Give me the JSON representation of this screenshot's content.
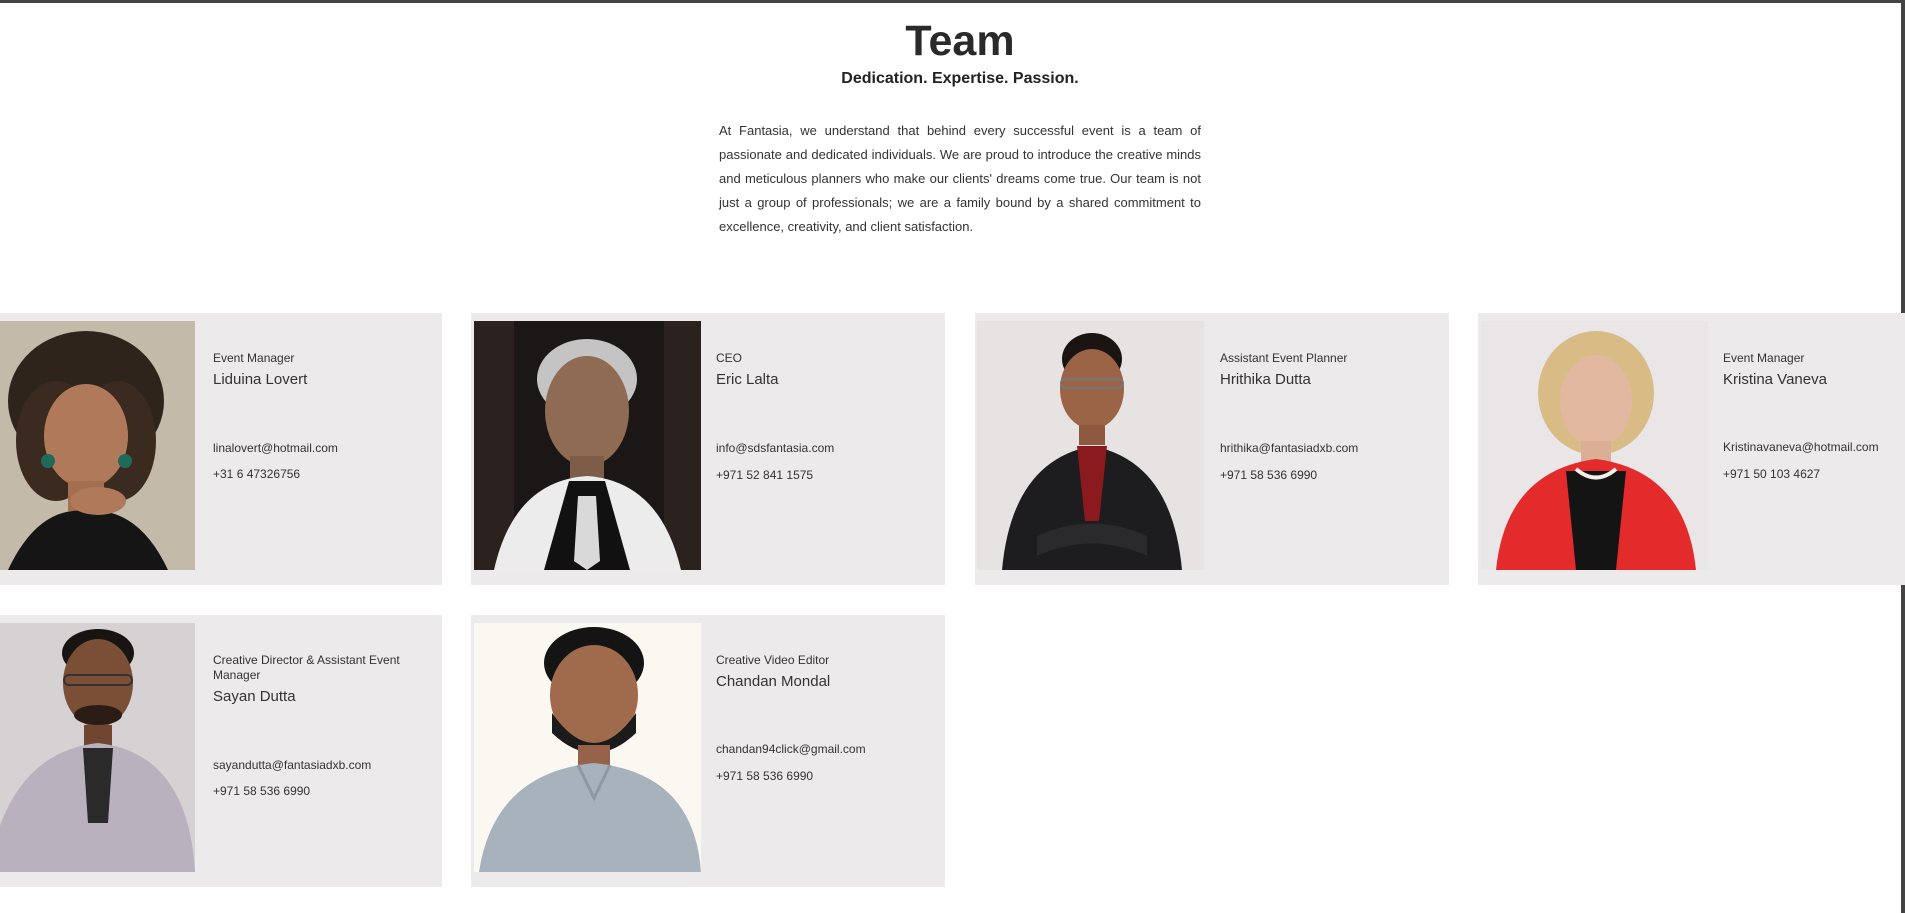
{
  "section": {
    "title": "Team",
    "subtitle": "Dedication. Expertise. Passion.",
    "intro": "At Fantasia, we understand that behind every successful event is a team of passionate and dedicated individuals. We are proud to introduce the creative minds and meticulous planners who make our clients' dreams come true. Our team is not just a group of professionals; we are a family bound by a shared commitment to excellence, creativity, and client satisfaction."
  },
  "members": [
    {
      "role": "Event Manager",
      "name": "Liduina Lovert",
      "email": "linalovert@hotmail.com",
      "phone": "+31 6 47326756"
    },
    {
      "role": "CEO",
      "name": "Eric Lalta",
      "email": "info@sdsfantasia.com",
      "phone": "+971 52 841 1575"
    },
    {
      "role": "Assistant Event Planner",
      "name": "Hrithika Dutta",
      "email": "hrithika@fantasiadxb.com",
      "phone": "+971 58 536 6990"
    },
    {
      "role": "Event Manager",
      "name": "Kristina Vaneva",
      "email": "Kristinavaneva@hotmail.com",
      "phone": "+971 50 103 4627"
    },
    {
      "role": "Creative Director & Assistant Event Manager",
      "name": "Sayan Dutta",
      "email": "sayandutta@fantasiadxb.com",
      "phone": "+971 58 536 6990"
    },
    {
      "role": "Creative Video Editor",
      "name": "Chandan Mondal",
      "email": "chandan94click@gmail.com",
      "phone": "+971 58 536 6990"
    }
  ],
  "colors": {
    "card_background": "#eceaea",
    "text": "#333333",
    "title": "#2a2a2a"
  }
}
